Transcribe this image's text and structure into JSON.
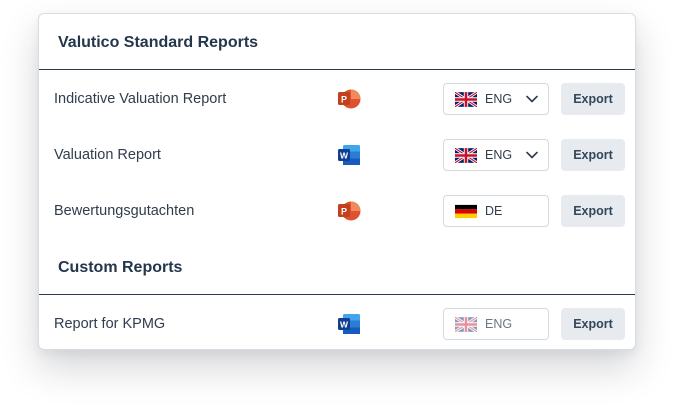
{
  "standard": {
    "title": "Valutico Standard Reports",
    "reports": [
      {
        "name": "Indicative Valuation Report",
        "app": "powerpoint-icon",
        "language": "ENG",
        "flag": "uk-flag-icon",
        "dropdown": true,
        "enabled": true,
        "export_label": "Export"
      },
      {
        "name": "Valuation Report",
        "app": "word-icon",
        "language": "ENG",
        "flag": "uk-flag-icon",
        "dropdown": true,
        "enabled": true,
        "export_label": "Export"
      },
      {
        "name": "Bewertungsgutachten",
        "app": "powerpoint-icon",
        "language": "DE",
        "flag": "germany-flag-icon",
        "dropdown": false,
        "enabled": true,
        "export_label": "Export"
      }
    ]
  },
  "custom": {
    "title": "Custom Reports",
    "reports": [
      {
        "name": "Report for KPMG",
        "app": "word-icon",
        "language": "ENG",
        "flag": "uk-flag-icon",
        "dropdown": false,
        "enabled": false,
        "export_label": "Export"
      }
    ]
  },
  "colors": {
    "powerpoint": "#e0522f",
    "word": "#1f5bbf",
    "export_bg": "#e7ebf0",
    "divider": "#2b3b4c"
  }
}
